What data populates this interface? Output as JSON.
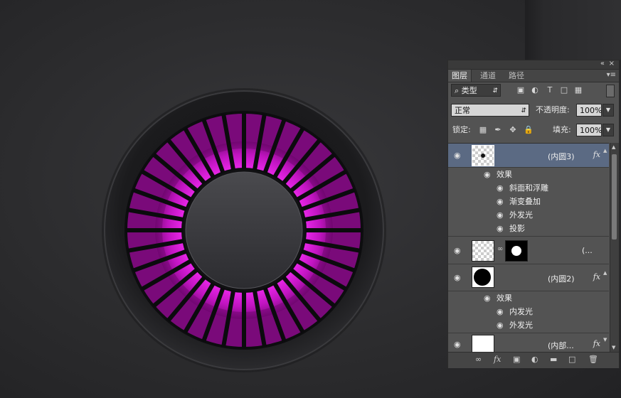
{
  "layers_panel": {
    "tabs": [
      "图层",
      "通道",
      "路径"
    ],
    "filter": {
      "label": "类型",
      "icon": "search-icon"
    },
    "blend_mode": "正常",
    "opacity_label": "不透明度:",
    "opacity_value": "100%",
    "lock_label": "锁定:",
    "fill_label": "填充:",
    "fill_value": "100%",
    "layers": [
      {
        "name": "(内圆3)",
        "selected": true,
        "has_fx": true,
        "effects_label": "效果",
        "effects": [
          "斜面和浮雕",
          "渐变叠加",
          "外发光",
          "投影"
        ]
      },
      {
        "name": "(...",
        "selected": false,
        "has_fx": false,
        "has_mask": true
      },
      {
        "name": "(内圆2)",
        "selected": false,
        "has_fx": true,
        "effects_label": "效果",
        "effects": [
          "内发光",
          "外发光"
        ]
      },
      {
        "name": "(内部...",
        "selected": false,
        "has_fx": true
      }
    ]
  },
  "colors": {
    "accent_magenta": "#d21ad2",
    "panel_bg": "#535353",
    "selected_row": "#5b6a83"
  }
}
